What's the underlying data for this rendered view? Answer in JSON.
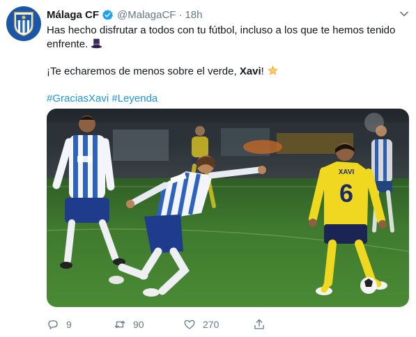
{
  "tweet": {
    "display_name": "Málaga CF",
    "handle": "@MalagaCF",
    "separator": "·",
    "time": "18h",
    "line1": "Has hecho disfrutar a todos con tu fútbol, incluso a los que te hemos tenido enfrente.",
    "line2_pre": "¡Te echaremos de menos sobre el verde, ",
    "line2_bold": "Xavi",
    "line2_post": "!",
    "hashtags": [
      "#GraciasXavi",
      "#Leyenda"
    ],
    "photo": {
      "jersey_name": "XAVI",
      "jersey_number": "6"
    }
  },
  "actions": {
    "replies": "9",
    "retweets": "90",
    "likes": "270"
  },
  "icons": {
    "verified": "verified-badge-icon",
    "caret": "chevron-down-icon",
    "reply": "reply-icon",
    "retweet": "retweet-icon",
    "like": "heart-icon",
    "share": "share-icon",
    "hat_emoji": "top-hat-emoji",
    "star_emoji": "glowing-star-emoji"
  },
  "colors": {
    "link": "#1b95e0",
    "verified": "#1da1f2",
    "muted": "#657786",
    "text": "#14171a"
  }
}
